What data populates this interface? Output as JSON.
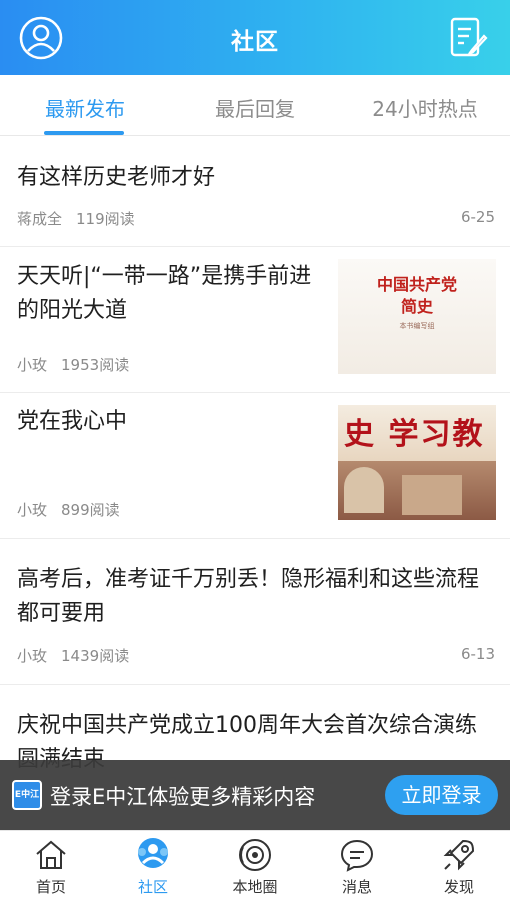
{
  "header": {
    "title": "社区",
    "avatar_icon": "user-avatar-icon",
    "edit_icon": "edit-post-icon"
  },
  "tabs": [
    {
      "label": "最新发布",
      "active": true
    },
    {
      "label": "最后回复",
      "active": false
    },
    {
      "label": "24小时热点",
      "active": false
    }
  ],
  "articles": [
    {
      "title": "有这样历史老师才好",
      "author": "蒋成全",
      "reads": "119阅读",
      "date": "6-25"
    },
    {
      "title_line1": "天天听|“一带一路”是携手前进",
      "title_line2": "的阳光大道",
      "author": "小玫",
      "reads": "1953阅读",
      "thumb_title": "中国共产党",
      "thumb_subtitle": "简史",
      "thumb_publisher": "本书编写组"
    },
    {
      "title": "党在我心中",
      "author": "小玫",
      "reads": "899阅读",
      "thumb_text": "史 学习教"
    },
    {
      "title_line1": "高考后，准考证千万别丢！隐形福利和这些流程",
      "title_line2": "都可要用",
      "author": "小玫",
      "reads": "1439阅读",
      "date": "6-13"
    },
    {
      "title_line1": "庆祝中国共产党成立100周年大会首次综合演练",
      "title_line2": "圆满结束"
    }
  ],
  "login_banner": {
    "logo_text": "E中江",
    "text": "登录E中江体验更多精彩内容",
    "button_label": "立即登录"
  },
  "bottom_nav": [
    {
      "label": "首页",
      "icon": "home-icon",
      "active": false
    },
    {
      "label": "社区",
      "icon": "community-icon",
      "active": true
    },
    {
      "label": "本地圈",
      "icon": "local-circle-icon",
      "active": false
    },
    {
      "label": "消息",
      "icon": "message-icon",
      "active": false
    },
    {
      "label": "发现",
      "icon": "discover-rocket-icon",
      "active": false
    }
  ],
  "colors": {
    "accent": "#2d9af0",
    "header_start": "#2a8df2",
    "header_end": "#38d0ea"
  }
}
